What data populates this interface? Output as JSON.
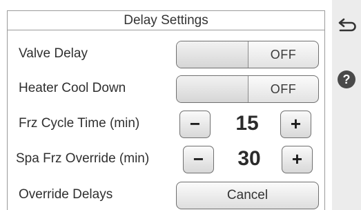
{
  "title": "Delay Settings",
  "rows": {
    "valve_delay": {
      "label": "Valve Delay",
      "state": "OFF"
    },
    "heater_cool_down": {
      "label": "Heater Cool Down",
      "state": "OFF"
    },
    "frz_cycle_time": {
      "label": "Frz Cycle Time (min)",
      "value": "15",
      "minus": "−",
      "plus": "+"
    },
    "spa_frz_override": {
      "label": "Spa Frz Override (min)",
      "value": "30",
      "minus": "−",
      "plus": "+"
    },
    "override_delays": {
      "label": "Override Delays",
      "button": "Cancel"
    }
  },
  "side": {
    "back_icon": "back-arrow-icon",
    "help_icon": "help-icon",
    "help_glyph": "?"
  },
  "colors": {
    "panel_border": "#9a9a9a",
    "rail": "#ececec",
    "help_bg": "#4a4a4a"
  }
}
